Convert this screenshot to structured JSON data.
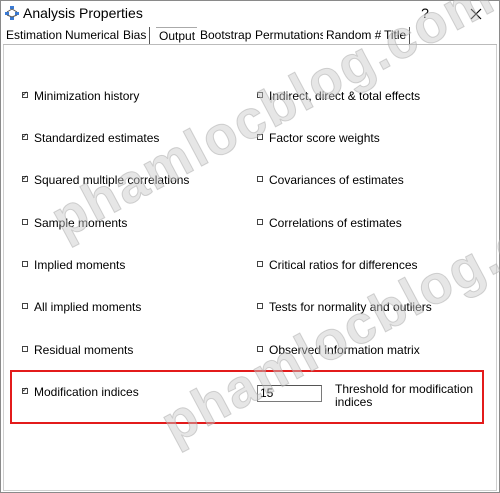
{
  "window": {
    "title": "Analysis Properties",
    "help_label": "?",
    "close_label": "X"
  },
  "tabs": [
    {
      "label": "Estimation"
    },
    {
      "label": "Numerical"
    },
    {
      "label": "Bias"
    },
    {
      "label": "Output",
      "active": true
    },
    {
      "label": "Bootstrap"
    },
    {
      "label": "Permutations"
    },
    {
      "label": "Random #"
    },
    {
      "label": "Title"
    }
  ],
  "output": {
    "left_options": [
      {
        "label": "Minimization history",
        "checked": true
      },
      {
        "label": "Standardized estimates",
        "checked": true
      },
      {
        "label": "Squared multiple correlations",
        "checked": true
      },
      {
        "label": "Sample moments",
        "checked": false
      },
      {
        "label": "Implied moments",
        "checked": false
      },
      {
        "label": "All implied moments",
        "checked": false
      },
      {
        "label": "Residual moments",
        "checked": false
      },
      {
        "label": "Modification indices",
        "checked": true
      }
    ],
    "right_options": [
      {
        "label": "Indirect, direct & total effects",
        "checked": false
      },
      {
        "label": "Factor score weights",
        "checked": false
      },
      {
        "label": "Covariances of estimates",
        "checked": false
      },
      {
        "label": "Correlations of estimates",
        "checked": false
      },
      {
        "label": "Critical ratios for differences",
        "checked": false
      },
      {
        "label": "Tests for normality and outliers",
        "checked": false
      },
      {
        "label": "Observed information matrix",
        "checked": false
      }
    ],
    "threshold_value": "15",
    "threshold_label": "Threshold for modification indices"
  },
  "watermark": "phamlocblog.com",
  "colors": {
    "highlight": "#e31b1b"
  }
}
